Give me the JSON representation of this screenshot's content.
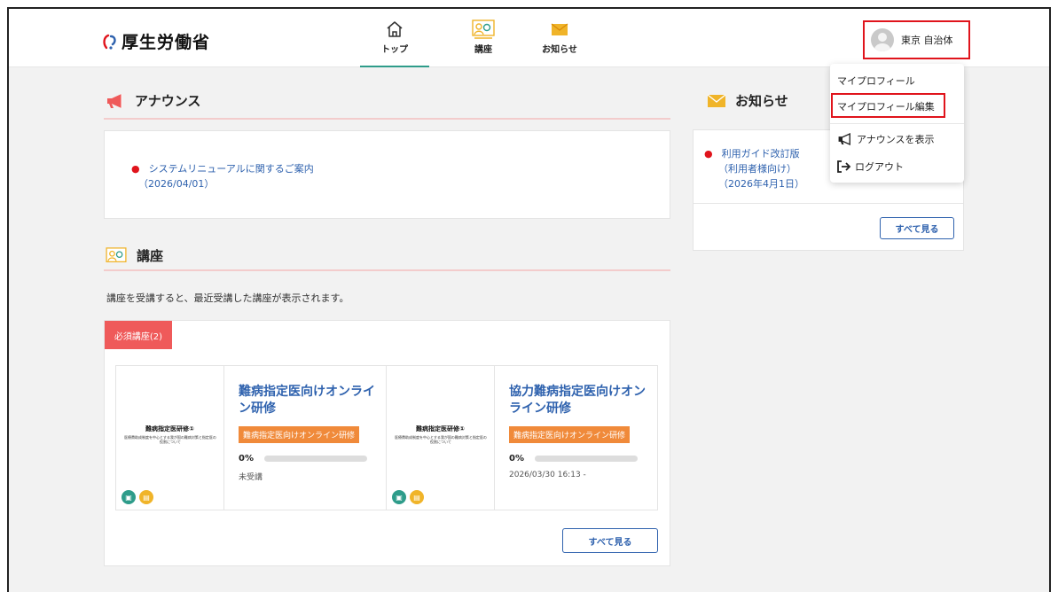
{
  "header": {
    "logo_text": "厚生労働省",
    "nav": [
      {
        "label": "トップ",
        "icon": "home-icon",
        "active": true
      },
      {
        "label": "講座",
        "icon": "course-icon",
        "active": false
      },
      {
        "label": "お知らせ",
        "icon": "mail-icon",
        "active": false
      }
    ],
    "user_name": "東京 自治体"
  },
  "dropdown": {
    "items": [
      {
        "label": "マイプロフィール"
      },
      {
        "label": "マイプロフィール編集",
        "highlighted": true
      },
      {
        "label": "アナウンスを表示",
        "icon": "megaphone-icon"
      },
      {
        "label": "ログアウト",
        "icon": "logout-icon"
      }
    ]
  },
  "announce": {
    "title": "アナウンス",
    "items": [
      {
        "text": "システムリニューアルに関するご案内",
        "date": "（2026/04/01）"
      }
    ]
  },
  "courses": {
    "title": "講座",
    "hint": "講座を受講すると、最近受講した講座が表示されます。",
    "tab_label": "必須講座(2)",
    "items": [
      {
        "thumb_title": "難病指定医研修①",
        "thumb_desc": "医療費助成制度を中心とする我が国の難病対策と指定医の役割について",
        "title": "難病指定医向けオンライン研修",
        "badge": "難病指定医向けオンライン研修",
        "progress": "0%",
        "progress_value": 0,
        "status": "未受講"
      },
      {
        "thumb_title": "難病指定医研修①",
        "thumb_desc": "医療費助成制度を中心とする我が国の難病対策と指定医の役割について",
        "title": "協力難病指定医向けオンライン研修",
        "badge": "難病指定医向けオンライン研修",
        "progress": "0%",
        "progress_value": 0,
        "status": "2026/03/30 16:13 -"
      }
    ],
    "more_label": "すべて見る"
  },
  "notices": {
    "title": "お知らせ",
    "items": [
      {
        "line1": "利用ガイド改訂版",
        "line2": "（利用者様向け）",
        "line3": "（2026年4月1日）"
      }
    ],
    "more_label": "すべて見る"
  },
  "colors": {
    "accent_teal": "#2e9c8a",
    "link_blue": "#2f62ae",
    "alert_red": "#e0141c",
    "badge_orange": "#f08a3a",
    "tab_red": "#ef5a5a",
    "icon_gold": "#f0b429"
  }
}
